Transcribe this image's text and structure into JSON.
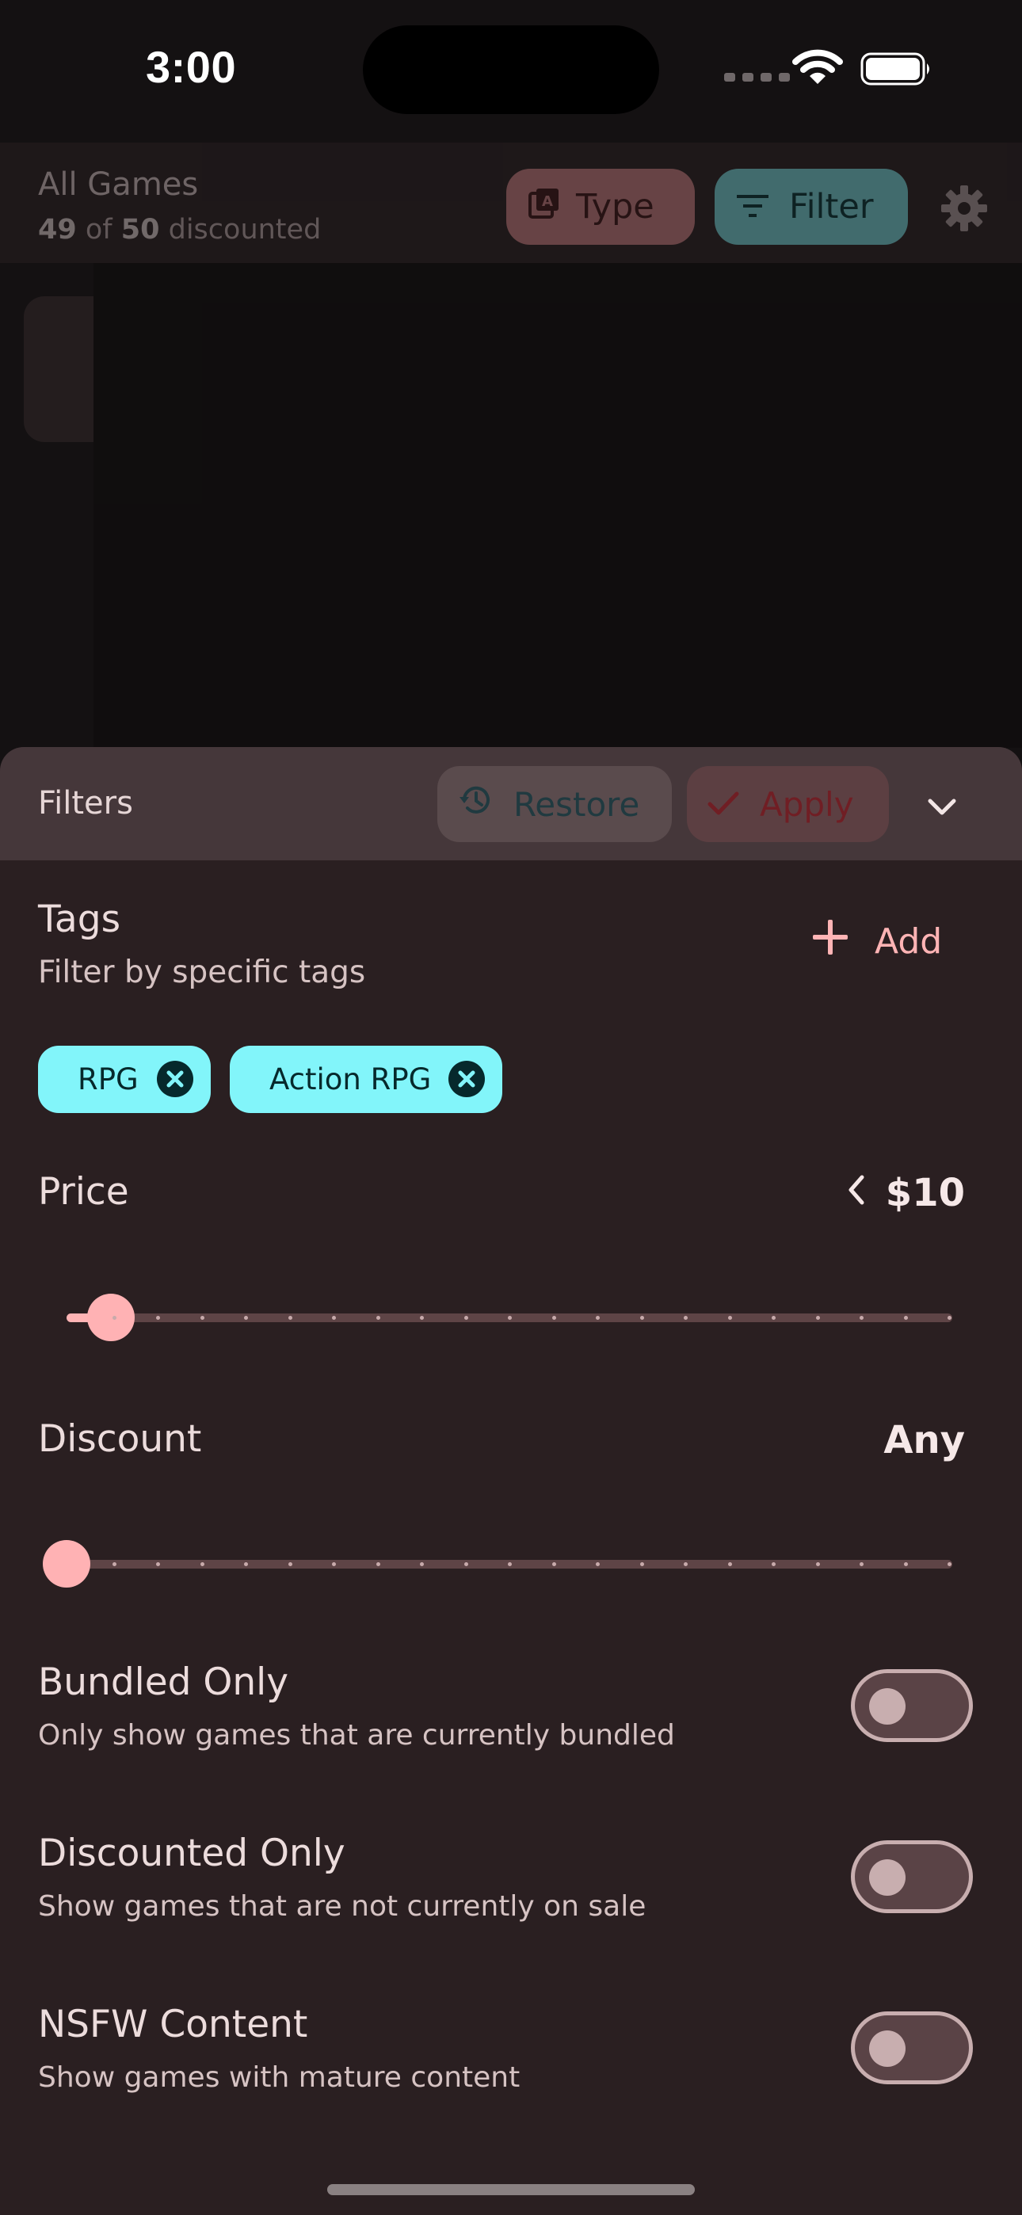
{
  "status_bar": {
    "time": "3:00"
  },
  "app_header": {
    "title": "All Games",
    "subtitle_count": "49",
    "subtitle_of": "of",
    "subtitle_total": "50",
    "subtitle_suffix": "discounted",
    "type_label": "Type",
    "filter_label": "Filter"
  },
  "sheet": {
    "title": "Filters",
    "restore_label": "Restore",
    "apply_label": "Apply"
  },
  "tags": {
    "title": "Tags",
    "subtitle": "Filter by specific tags",
    "add_label": "Add",
    "items": [
      {
        "label": "RPG"
      },
      {
        "label": "Action RPG"
      }
    ]
  },
  "price": {
    "title": "Price",
    "value": "$10",
    "slider_fraction": 0.05
  },
  "discount": {
    "title": "Discount",
    "value": "Any",
    "slider_fraction": 0.0
  },
  "toggles": [
    {
      "title": "Bundled Only",
      "subtitle": "Only show games that are currently bundled",
      "on": false
    },
    {
      "title": "Discounted Only",
      "subtitle": "Show games that are not currently on sale",
      "on": false
    },
    {
      "title": "NSFW Content",
      "subtitle": "Show games with mature content",
      "on": false
    }
  ],
  "colors": {
    "accent_pink": "#ffb4b5",
    "chip_cyan": "#82f5fa",
    "sheet_background": "#2a1f21",
    "sheet_header": "#45373a"
  }
}
